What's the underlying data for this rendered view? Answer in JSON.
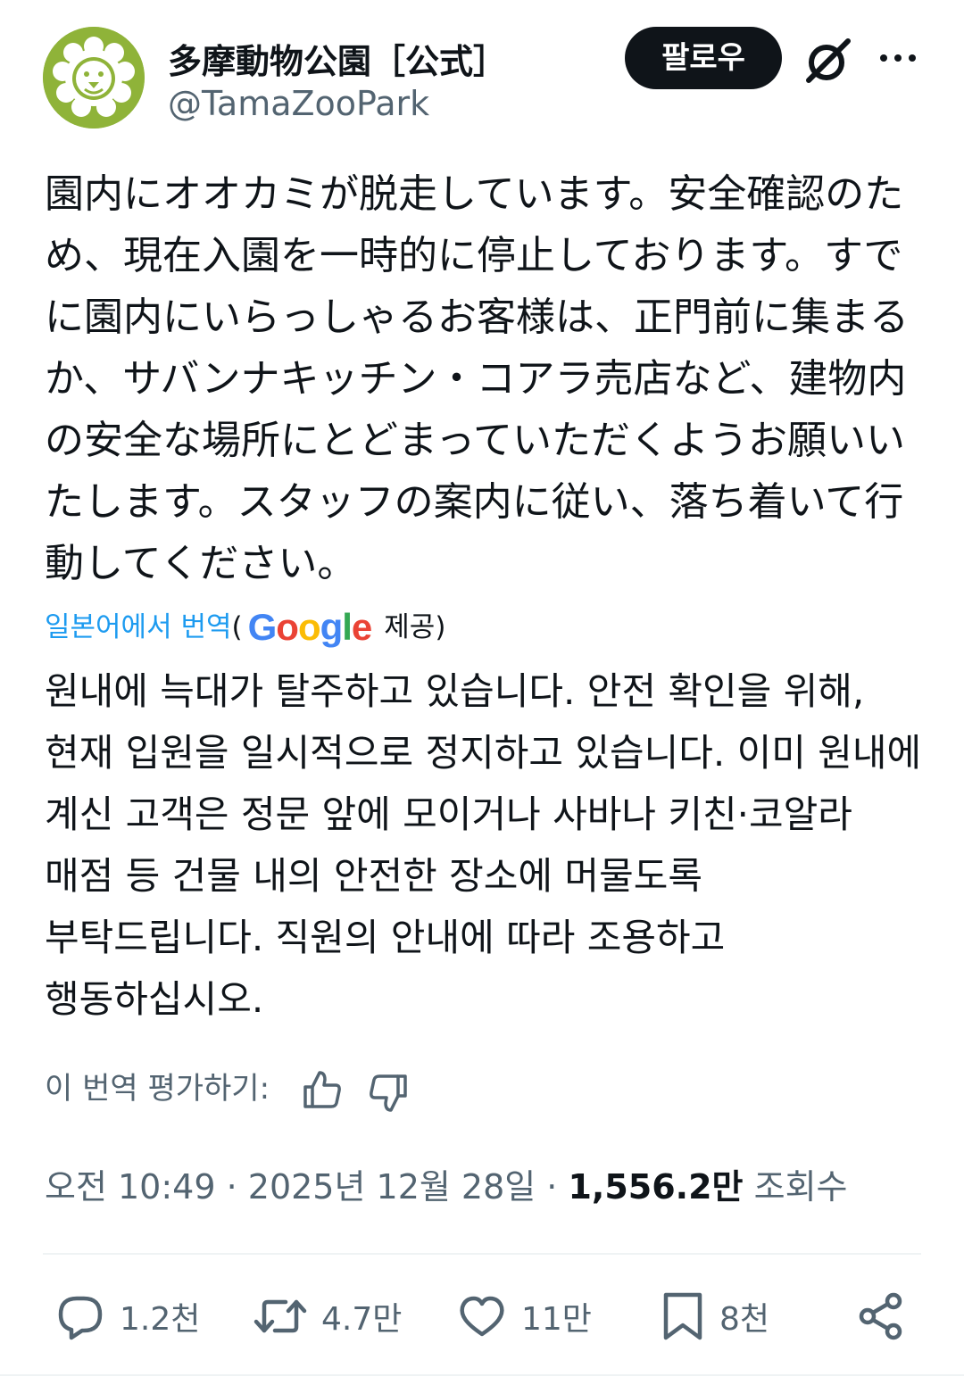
{
  "author": {
    "display_name": "多摩動物公園［公式］",
    "handle": "@TamaZooPark",
    "avatar_color": "#8fb339"
  },
  "header": {
    "follow_label": "팔로우"
  },
  "post": {
    "text": "園内にオオカミが脱走しています。安全確認のため、現在入園を一時的に停止しております。すでに園内にいらっしゃるお客様は、正門前に集まるか、サバンナキッチン・コアラ売店など、建物内の安全な場所にとどまっていただくようお願いいたします。スタッフの案内に従い、落ち着いて行動してください。",
    "translate_link": "일본어에서 번역",
    "translate_provider": "Google",
    "translate_provided": "제공",
    "translated_text": "원내에 늑대가 탈주하고 있습니다. 안전 확인을 위해, 현재 입원을 일시적으로 정지하고 있습니다. 이미 원내에 계신 고객은 정문 앞에 모이거나 사바나 키친·코알라 매점 등 건물 내의 안전한 장소에 머물도록 부탁드립니다. 직원의 안내에 따라 조용하고 행동하십시오.",
    "rate_label": "이 번역 평가하기:"
  },
  "meta": {
    "time": "오전 10:49",
    "date": "2025년 12월 28일",
    "views_count": "1,556.2만",
    "views_label": "조회수"
  },
  "actions": {
    "replies": "1.2천",
    "reposts": "4.7만",
    "likes": "11만",
    "bookmarks": "8천"
  },
  "icons": {
    "avatar": "lion-face-icon",
    "grok": "grok-icon",
    "more": "more-dots-icon",
    "thumbs_up": "thumbs-up-icon",
    "thumbs_down": "thumbs-down-icon",
    "reply": "reply-bubble-icon",
    "repost": "repost-icon",
    "like": "heart-icon",
    "bookmark": "bookmark-icon",
    "share": "share-icon"
  },
  "colors": {
    "text_primary": "#0f1419",
    "text_secondary": "#536471",
    "link": "#1d9bf0",
    "divider": "#eff3f4",
    "google_blue": "#4285f4",
    "google_red": "#ea4335",
    "google_yellow": "#fbbc05",
    "google_green": "#34a853"
  }
}
